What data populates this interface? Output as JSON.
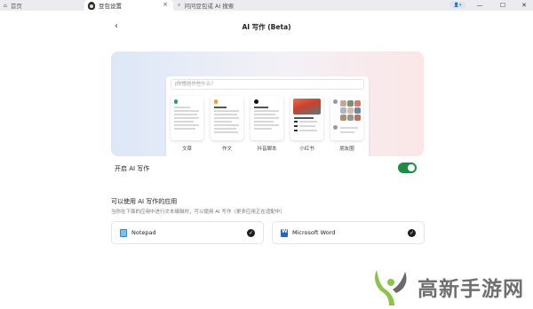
{
  "tabs": {
    "home": "首页",
    "settings": "豆包设置",
    "search": "问问豆包或 AI 搜索",
    "close": "×"
  },
  "window": {
    "user_badge": "👤▾",
    "minimize": "—",
    "maximize": "☐",
    "close": "✕"
  },
  "header": {
    "back": "‹",
    "title": "AI 写作 (Beta)"
  },
  "hero": {
    "prompt_placeholder": "你想创作些什么？",
    "cards": [
      {
        "label": "文章"
      },
      {
        "label": "作文"
      },
      {
        "label": "抖音脚本"
      },
      {
        "label": "小红书"
      },
      {
        "label": "朋友圈"
      }
    ]
  },
  "ai_toggle": {
    "label": "开启 AI 写作",
    "enabled": true
  },
  "apps_section": {
    "title": "可以使用 AI 写作的应用",
    "subtitle": "当你在下面的应用中进行文本编辑时，可以使用 AI 写作（更多应用正在适配中）",
    "apps": [
      {
        "name": "Notepad",
        "icon": "notepad-icon",
        "checked": true
      },
      {
        "name": "Microsoft Word",
        "icon": "word-icon",
        "checked": true
      }
    ]
  },
  "watermark": {
    "text": "高新手游网"
  },
  "colors": {
    "toggle_on": "#1e8c45",
    "accent_red": "#d24a4a",
    "word_blue": "#2b62c2"
  }
}
